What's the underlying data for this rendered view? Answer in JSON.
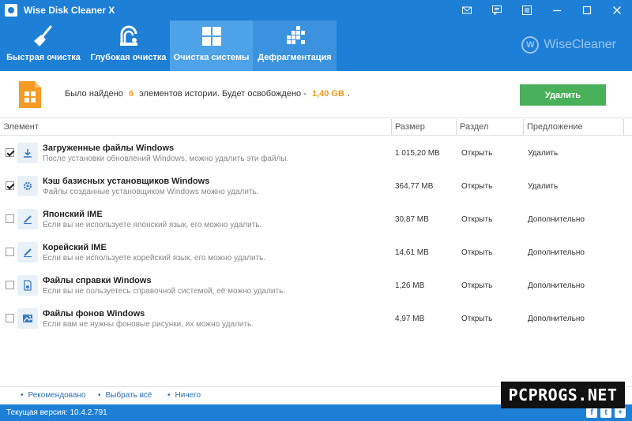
{
  "window": {
    "title": "Wise Disk Cleaner X"
  },
  "nav": {
    "tabs": [
      {
        "label": "Быстрая очистка",
        "icon": "broom-icon"
      },
      {
        "label": "Глубокая очистка",
        "icon": "vacuum-icon"
      },
      {
        "label": "Очистка системы",
        "icon": "windows-icon"
      },
      {
        "label": "Дефрагментация",
        "icon": "defrag-icon"
      }
    ],
    "brand": "WiseCleaner",
    "brand_mark": "W"
  },
  "summary": {
    "prefix": "Было найдено",
    "count": "6",
    "middle": "элементов истории. Будет освобождено -",
    "size": "1,40 GB",
    "suffix": ".",
    "delete_label": "Удалить"
  },
  "table": {
    "headers": {
      "element": "Элемент",
      "size": "Размер",
      "section": "Раздел",
      "suggestion": "Предложение"
    },
    "rows": [
      {
        "checked": true,
        "icon": "download-icon",
        "name": "Загруженные файлы Windows",
        "desc": "После установки обновлений Windows, можно удалить эти файлы.",
        "size": "1 015,20 MB",
        "section": "Открыть",
        "suggestion": "Удалить"
      },
      {
        "checked": true,
        "icon": "gear-icon",
        "name": "Кэш базисных установщиков Windows",
        "desc": "Файлы созданные установщиком Windows можно удалить.",
        "size": "364,77 MB",
        "section": "Открыть",
        "suggestion": "Удалить"
      },
      {
        "checked": false,
        "icon": "pen-icon",
        "name": "Японский IME",
        "desc": "Если вы не используете японский язык, его можно удалить.",
        "size": "30,87 MB",
        "section": "Открыть",
        "suggestion": "Дополнительно"
      },
      {
        "checked": false,
        "icon": "pen-icon",
        "name": "Корейский IME",
        "desc": "Если вы не используете корейский язык, его можно удалить.",
        "size": "14,61 MB",
        "section": "Открыть",
        "suggestion": "Дополнительно"
      },
      {
        "checked": false,
        "icon": "help-file-icon",
        "name": "Файлы справки Windows",
        "desc": "Если вы не пользуетесь справочной системой, её можно удалить.",
        "size": "1,26 MB",
        "section": "Открыть",
        "suggestion": "Дополнительно"
      },
      {
        "checked": false,
        "icon": "image-icon",
        "name": "Файлы фонов Windows",
        "desc": "Если вам не нужны фоновые рисунки, их можно удалить.",
        "size": "4,97 MB",
        "section": "Открыть",
        "suggestion": "Дополнительно"
      }
    ]
  },
  "footer": {
    "links": [
      "Рекомендовано",
      "Выбрать всё",
      "Ничего"
    ]
  },
  "status": {
    "version": "Текущая версия: 10.4.2.791"
  },
  "watermark": "PCPROGS.NET",
  "colors": {
    "primary": "#1e7fd6",
    "active_tab": "#4ea2e8",
    "delete_button": "#49b05a",
    "highlight": "#f09b1e"
  }
}
